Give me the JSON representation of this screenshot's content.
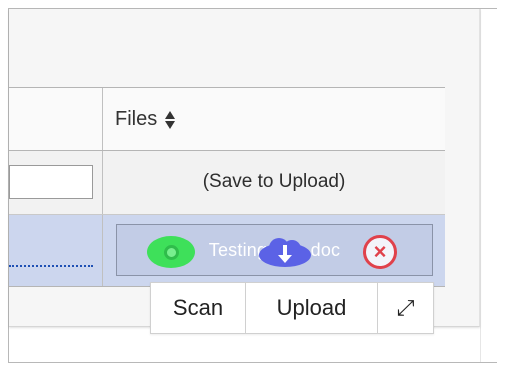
{
  "table": {
    "files_header": "Files",
    "save_to_upload": "(Save to Upload)",
    "file_name": "Testing files.doc"
  },
  "actions": {
    "scan": "Scan",
    "upload": "Upload",
    "expand": "⤢"
  },
  "colors": {
    "row_highlight": "#ccd6ee",
    "scan": "#3ee05a",
    "upload": "#5b62e6",
    "cancel": "#e0414b",
    "link": "#1e50b4"
  },
  "icons": {
    "sort": "sort-icon",
    "scan": "scan-icon",
    "upload": "cloud-upload-icon",
    "cancel": "cancel-icon",
    "expand": "expand-icon"
  }
}
